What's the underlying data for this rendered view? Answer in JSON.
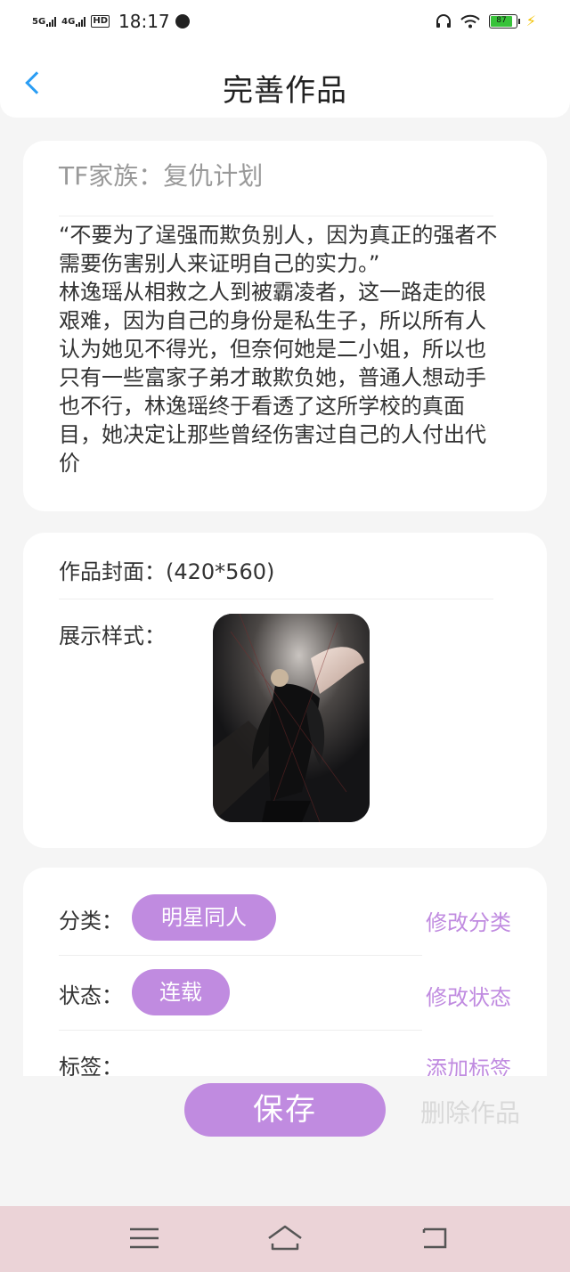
{
  "status_bar": {
    "net1": "5G",
    "net2": "4G",
    "hd": "HD",
    "time": "18:17",
    "battery": "87",
    "icons": [
      "signal-icon",
      "hd-icon",
      "app-notification-icon",
      "headphones-icon",
      "wifi-icon",
      "battery-icon",
      "charging-icon"
    ]
  },
  "header": {
    "title": "完善作品",
    "back_icon": "chevron-left-icon"
  },
  "work": {
    "title": "TF家族：复仇计划",
    "description": "“不要为了逞强而欺负别人，因为真正的强者不需要伤害别人来证明自己的实力。”\n林逸瑶从相救之人到被霸凌者，这一路走的很艰难，因为自己的身份是私生子，所以所有人认为她见不得光，但奈何她是二小姐，所以也只有一些富家子弟才敢欺负她，普通人想动手也不行，林逸瑶终于看透了这所学校的真面目，她决定让那些曾经伤害过自己的人付出代价"
  },
  "cover": {
    "label": "作品封面：(420*560)",
    "style_label": "展示样式："
  },
  "meta": {
    "category_label": "分类：",
    "category_value": "明星同人",
    "category_action": "修改分类",
    "status_label": "状态：",
    "status_value": "连载",
    "status_action": "修改状态",
    "tags_label": "标签：",
    "tags_action": "添加标签"
  },
  "actions": {
    "save": "保存",
    "delete": "删除作品"
  },
  "nav_bar": {
    "icons": [
      "menu-icon",
      "home-icon",
      "back-icon"
    ]
  },
  "colors": {
    "accent": "#c08be0",
    "back_arrow": "#2a9df4",
    "nav_bar_bg": "#ebd3d7"
  }
}
